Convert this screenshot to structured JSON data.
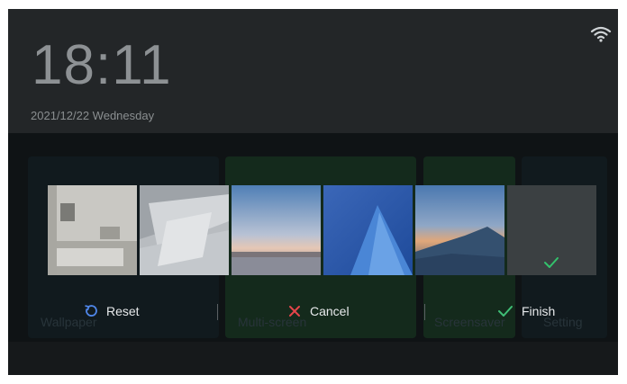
{
  "status": {
    "time": "18:11",
    "date": "2021/12/22 Wednesday",
    "wifi_icon": "wifi-icon"
  },
  "background_menu": {
    "items": [
      "Wallpaper",
      "Multi-screen",
      "Screensaver",
      "Setting"
    ]
  },
  "wallpaper_picker": {
    "thumbnails": [
      {
        "name": "interior-room"
      },
      {
        "name": "white-architecture"
      },
      {
        "name": "sunset-lake"
      },
      {
        "name": "blue-wave"
      },
      {
        "name": "mountain-dusk"
      },
      {
        "name": "solid-gray",
        "selected": true
      }
    ],
    "check_icon": "check-icon"
  },
  "actions": {
    "reset_label": "Reset",
    "cancel_label": "Cancel",
    "finish_label": "Finish"
  },
  "colors": {
    "reset_icon": "#4f86e8",
    "cancel_icon": "#e5454a",
    "finish_icon": "#3fbf76",
    "check": "#33c26c"
  }
}
